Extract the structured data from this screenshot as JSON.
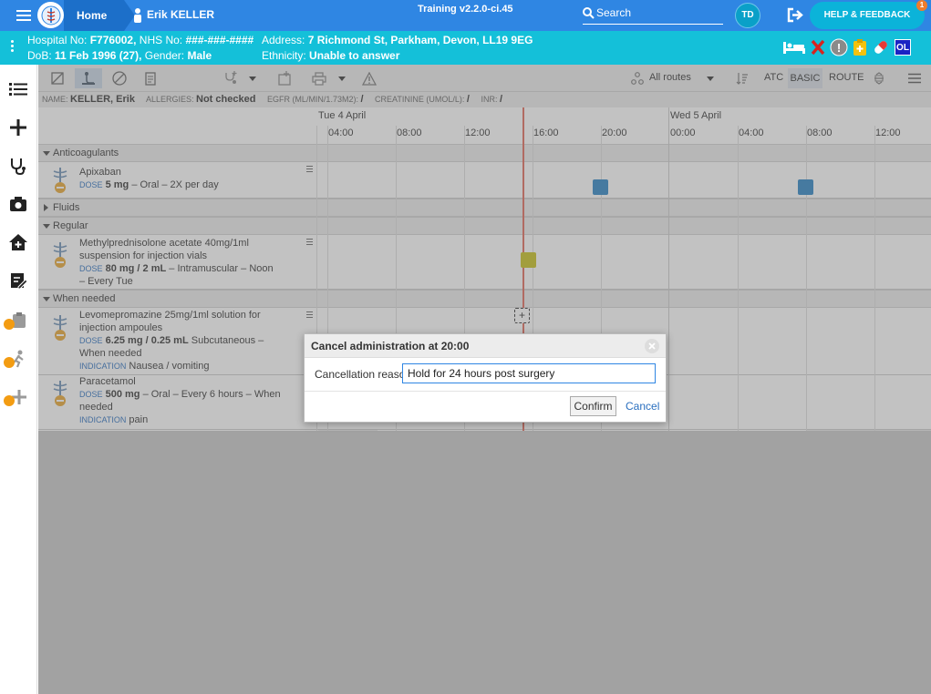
{
  "topbar": {
    "home_label": "Home",
    "patient_name": "Erik KELLER",
    "training_label": "Training v2.2.0-ci.45",
    "search_label": "Search",
    "avatar_initials": "TD",
    "help_label": "HELP & FEEDBACK",
    "help_badge": "1"
  },
  "banner": {
    "hospital_no_label": "Hospital No:",
    "hospital_no": "F776002,",
    "nhs_label": "NHS No:",
    "nhs_no": "###-###-####",
    "address_label": "Address:",
    "address": "7 Richmond St, Parkham, Devon, LL19 9EG",
    "dob_label": "DoB:",
    "dob": "11 Feb 1996 (27),",
    "gender_label": "Gender:",
    "gender": "Male",
    "ethnicity_label": "Ethnicity:",
    "ethnicity": "Unable to answer",
    "ol_badge": "OL",
    "alert_mark": "!"
  },
  "sidebar": {
    "items": [
      "list-icon",
      "add-icon",
      "stethoscope-icon",
      "camera-icon",
      "home-icon",
      "document-edit-icon",
      "locked-clipboard-icon",
      "locked-person-icon",
      "locked-add-icon"
    ]
  },
  "toolbar": {
    "routes_label": "All routes",
    "atc_label": "ATC",
    "basic_label": "BASIC",
    "route_label": "ROUTE"
  },
  "infostrip": {
    "name_label": "NAME:",
    "name": "KELLER, Erik",
    "allergies_label": "ALLERGIES:",
    "allergies": "Not checked",
    "egfr_label": "EGFR (ML/MIN/1.73M2):",
    "egfr": "/",
    "creatinine_label": "CREATININE (UMOL/L):",
    "creatinine": "/",
    "inr_label": "INR:",
    "inr": "/"
  },
  "timeline": {
    "dates": [
      "Tue 4 April",
      "Wed 5 April"
    ],
    "ticks": [
      "04:00",
      "08:00",
      "12:00",
      "16:00",
      "20:00",
      "00:00",
      "04:00",
      "08:00",
      "12:00"
    ]
  },
  "sections": {
    "anticoagulants": "Anticoagulants",
    "fluids": "Fluids",
    "regular": "Regular",
    "when_needed": "When needed"
  },
  "drugs": {
    "apixaban": {
      "name": "Apixaban",
      "dose_key": "DOSE",
      "dose": "5 mg",
      "detail": "– Oral – 2X per day"
    },
    "methylpred": {
      "name": "Methylprednisolone acetate 40mg/1ml suspension for injection vials",
      "dose_key": "DOSE",
      "dose": "80 mg / 2 mL",
      "detail": "– Intramuscular – Noon – Every Tue"
    },
    "levomepromazine": {
      "name": "Levomepromazine 25mg/1ml solution for injection ampoules",
      "dose_key": "DOSE",
      "dose": "6.25 mg / 0.25 mL",
      "detail": "Subcutaneous – When needed",
      "indication_key": "INDICATION",
      "indication": "Nausea / vomiting"
    },
    "paracetamol": {
      "name": "Paracetamol",
      "dose_key": "DOSE",
      "dose": "500 mg",
      "detail": "– Oral – Every 6 hours – When needed",
      "indication_key": "INDICATION",
      "indication": "pain"
    }
  },
  "dialog": {
    "title": "Cancel administration at 20:00",
    "reason_label": "Cancellation reason",
    "reason_value": "Hold for 24 hours post surgery",
    "confirm_label": "Confirm",
    "cancel_label": "Cancel"
  },
  "colors": {
    "primary": "#2f86e3",
    "banner": "#14c0d9",
    "administration_given": "#2a84c4",
    "administration_due": "#c8c21a",
    "now_line": "#e26a5b"
  }
}
